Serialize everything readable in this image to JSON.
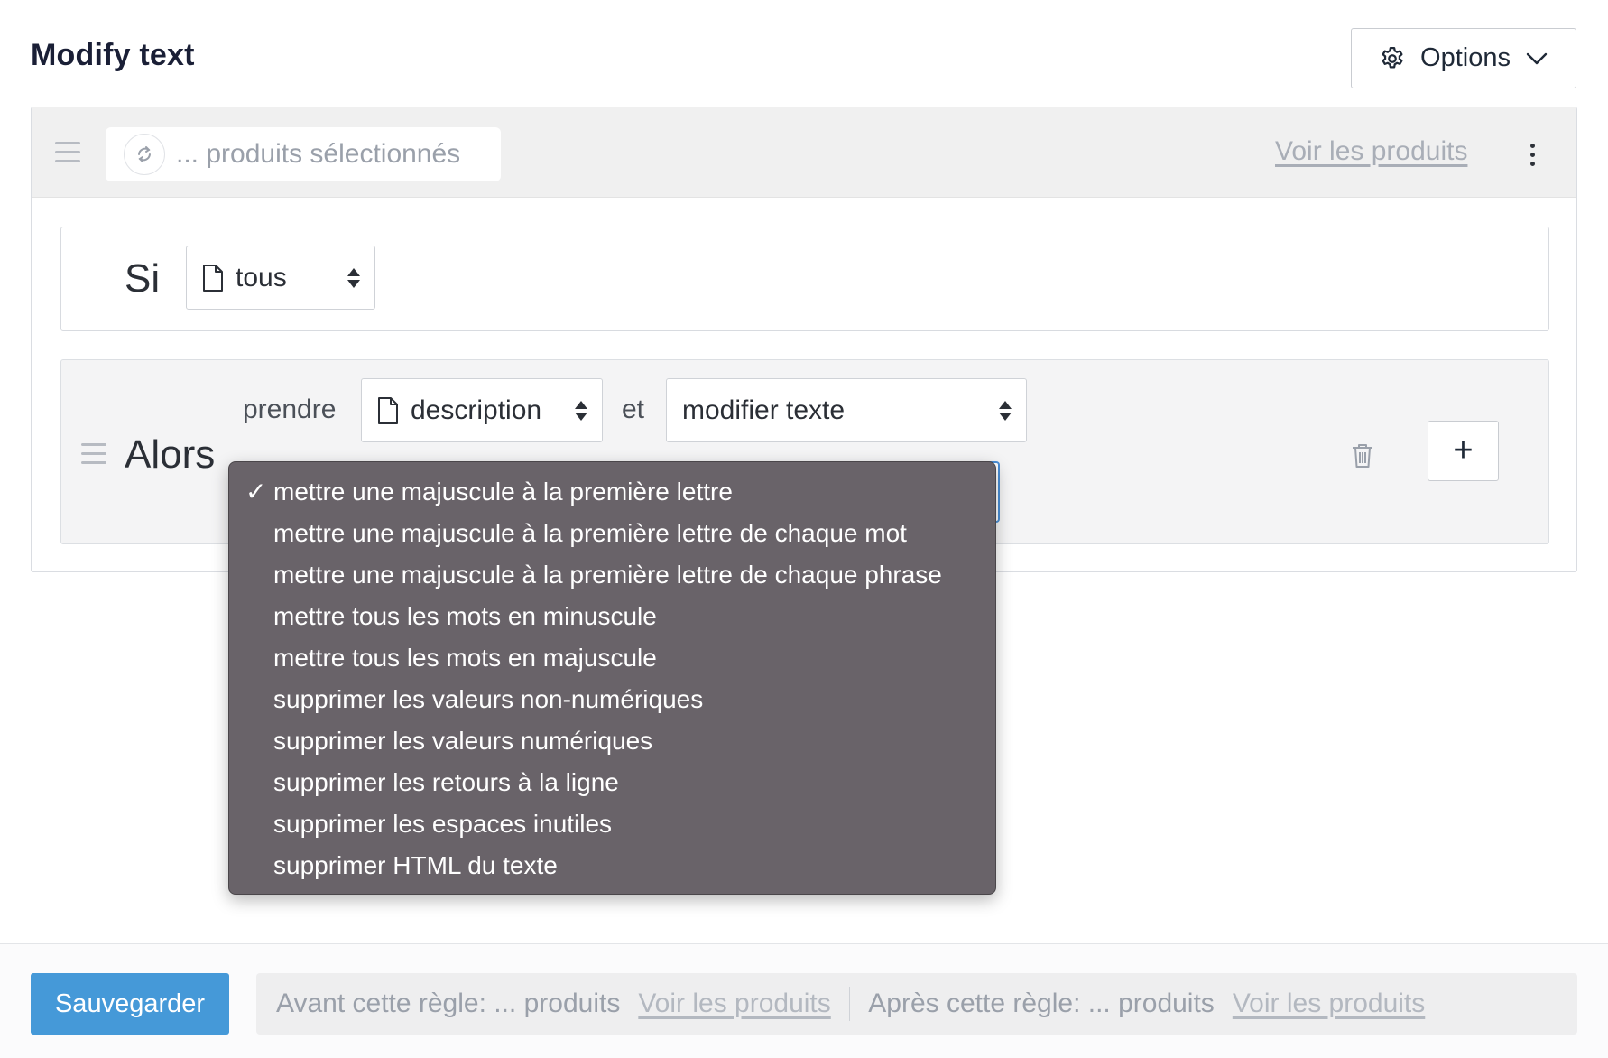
{
  "header": {
    "title": "Modify text",
    "options_label": "Options"
  },
  "selection": {
    "text": "... produits sélectionnés",
    "view_link": "Voir les produits"
  },
  "condition": {
    "si_label": "Si",
    "scope_value": "tous"
  },
  "action": {
    "alors_label": "Alors",
    "prendre_label": "prendre",
    "field_value": "description",
    "et_label": "et",
    "operation_value": "modifier texte",
    "add_label": "+"
  },
  "dropdown": {
    "check": "✓",
    "items": [
      "mettre une majuscule à la première lettre",
      "mettre une majuscule à la première lettre de chaque mot",
      "mettre une majuscule à la première lettre de chaque phrase",
      "mettre tous les mots en minuscule",
      "mettre tous les mots en majuscule",
      "supprimer les valeurs non-numériques",
      "supprimer les valeurs numériques",
      "supprimer les retours à la ligne",
      "supprimer les espaces inutiles",
      "supprimer HTML du texte"
    ],
    "selected_index": 0
  },
  "footer": {
    "save_label": "Sauvegarder",
    "before_text": "Avant cette règle: ... produits",
    "before_link": "Voir les produits",
    "after_text": "Après cette règle: ... produits",
    "after_link": "Voir les produits"
  },
  "colors": {
    "primary": "#4599d8",
    "dropdown_bg": "#696369",
    "focus": "#4b8fd6"
  }
}
